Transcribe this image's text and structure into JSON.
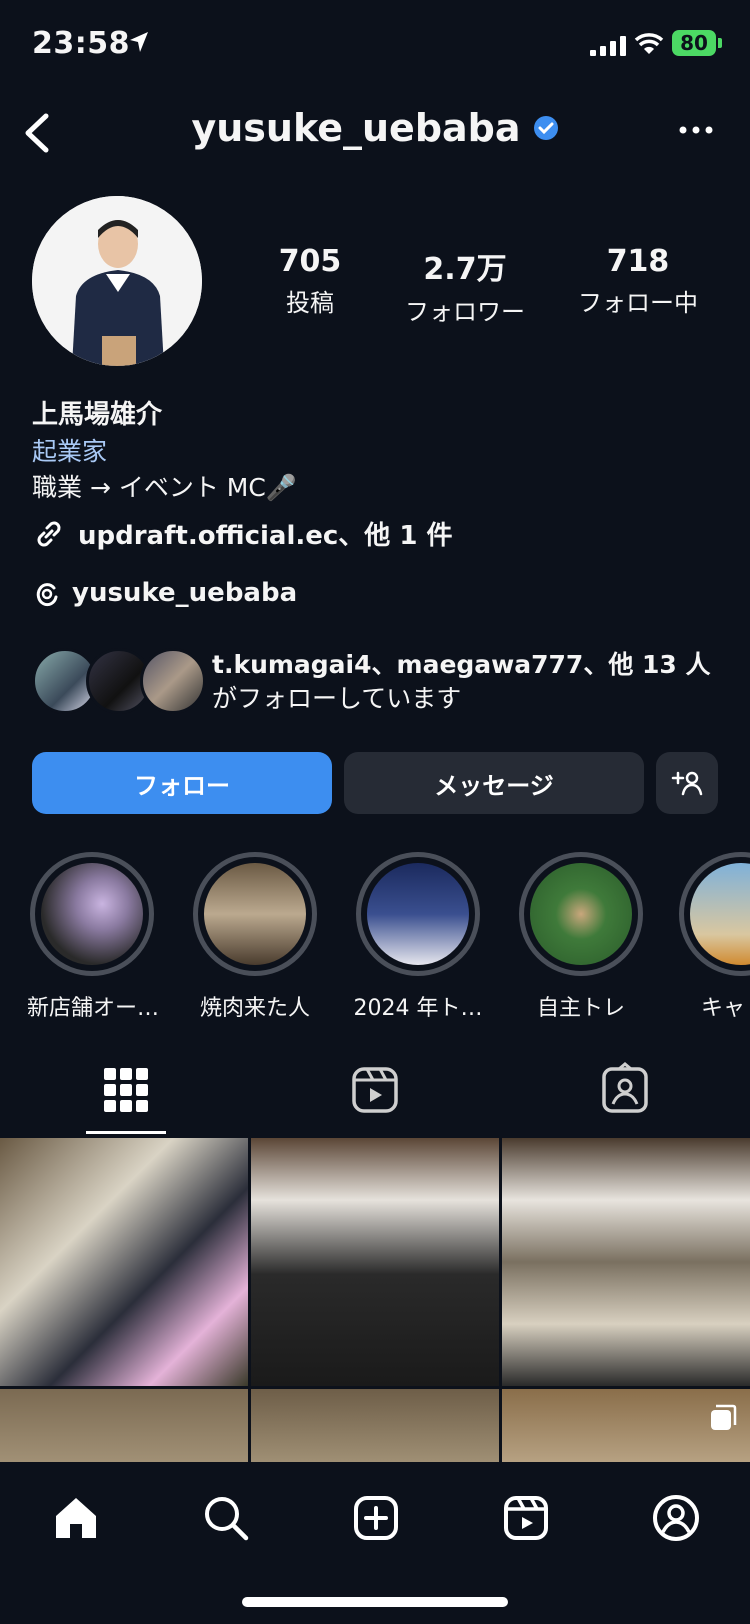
{
  "status_bar": {
    "time": "23:58",
    "battery": "80"
  },
  "header": {
    "username": "yusuke_uebaba"
  },
  "profile": {
    "stats": [
      {
        "value": "705",
        "label": "投稿"
      },
      {
        "value": "2.7万",
        "label": "フォロワー"
      },
      {
        "value": "718",
        "label": "フォロー中"
      }
    ],
    "name": "上馬場雄介",
    "category": "起業家",
    "bio": "職業 → イベント MC🎤",
    "link": "updraft.official.ec、他 1 件",
    "threads": "yusuke_uebaba",
    "mutual_line1": "t.kumagai4、maegawa777、他 13 人",
    "mutual_line2": "がフォローしています"
  },
  "buttons": {
    "follow": "フォロー",
    "message": "メッセージ"
  },
  "highlights": [
    {
      "label": "新店舗オー…"
    },
    {
      "label": "焼肉来た人"
    },
    {
      "label": "2024 年ト…"
    },
    {
      "label": "自主トレ"
    },
    {
      "label": "キャ"
    }
  ],
  "colors": {
    "accent": "#3d8ef0",
    "verified": "#3d8ef0",
    "background": "#0c111b",
    "button_secondary": "#262b35"
  },
  "icons": [
    "back-icon",
    "verified-icon",
    "more-icon",
    "link-icon",
    "threads-icon",
    "add-person-icon",
    "grid-icon",
    "reels-icon",
    "tagged-icon",
    "home-icon",
    "search-icon",
    "create-icon",
    "reels-nav-icon",
    "profile-icon"
  ]
}
